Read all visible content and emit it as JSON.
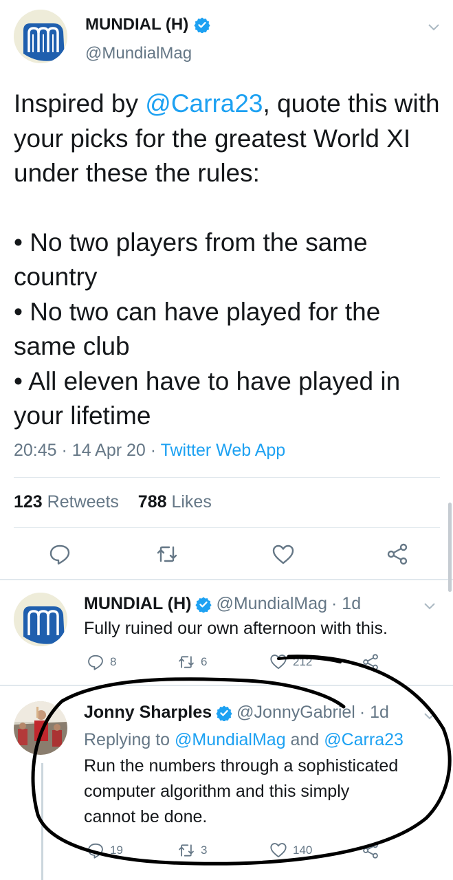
{
  "main_tweet": {
    "display_name": "MUNDIAL (H)",
    "handle": "@MundialMag",
    "text_prefix": "Inspired by ",
    "mention": "@Carra23",
    "text_after_mention": ", quote this with your picks for the greatest World XI under these the rules:",
    "rules": [
      "• No two players from the same country",
      "• No two can have played for the same club",
      "• All eleven have to have played in your lifetime"
    ],
    "time": "20:45",
    "date": "14 Apr 20",
    "source": "Twitter Web App",
    "retweets_count": "123",
    "retweets_label": "Retweets",
    "likes_count": "788",
    "likes_label": "Likes"
  },
  "reply_1": {
    "display_name": "MUNDIAL (H)",
    "handle": "@MundialMag",
    "age": "· 1d",
    "text": "Fully ruined our own afternoon with this.",
    "replies": "8",
    "retweets": "6",
    "likes": "212"
  },
  "reply_2": {
    "display_name": "Jonny Sharples",
    "handle": "@JonnyGabriel",
    "age": "· 1d",
    "replying_label": "Replying to",
    "replying_to_1": "@MundialMag",
    "replying_and": "and",
    "replying_to_2": "@Carra23",
    "text_line_1": "Run the numbers through a sophisticated",
    "text_line_2": "computer algorithm and this simply",
    "text_line_3": "cannot be done.",
    "replies": "19",
    "retweets": "3",
    "likes": "140"
  },
  "colors": {
    "link": "#1da1f2",
    "secondary_text": "#657786",
    "primary_text": "#14171a",
    "logo_blue": "#1f5fae",
    "annotation_ink": "#000000"
  }
}
